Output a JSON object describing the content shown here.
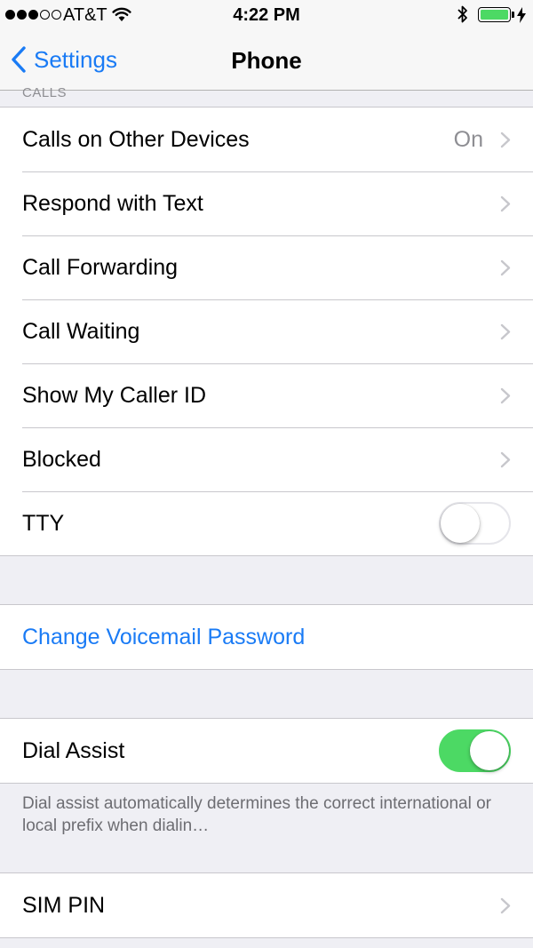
{
  "status_bar": {
    "carrier": "AT&T",
    "time": "4:22 PM",
    "signal_bars_filled": 3,
    "signal_bars_total": 5,
    "battery_level": 1.0,
    "battery_color": "#4cd964",
    "icons": [
      "signal-dots",
      "wifi-icon",
      "bluetooth-icon",
      "battery-icon",
      "charging-bolt-icon"
    ]
  },
  "nav": {
    "back_label": "Settings",
    "title": "Phone",
    "back_icon": "chevron-left-icon"
  },
  "calls_section": {
    "header": "CALLS",
    "rows": [
      {
        "label": "Calls on Other Devices",
        "value": "On",
        "accessory": "chevron"
      },
      {
        "label": "Respond with Text",
        "accessory": "chevron"
      },
      {
        "label": "Call Forwarding",
        "accessory": "chevron"
      },
      {
        "label": "Call Waiting",
        "accessory": "chevron"
      },
      {
        "label": "Show My Caller ID",
        "accessory": "chevron"
      },
      {
        "label": "Blocked",
        "accessory": "chevron"
      },
      {
        "label": "TTY",
        "accessory": "toggle",
        "on": false
      }
    ]
  },
  "voicemail": {
    "change_password_label": "Change Voicemail Password"
  },
  "dial_assist": {
    "label": "Dial Assist",
    "on": true,
    "footer": "Dial assist automatically determines the correct international or local prefix when dialin…"
  },
  "sim": {
    "label": "SIM PIN",
    "accessory": "chevron"
  },
  "colors": {
    "accent": "#1a7bf5",
    "toggle_on": "#4cd964",
    "background": "#efeff4",
    "separator": "#c8c7cc",
    "secondary_text": "#8e8e93"
  }
}
